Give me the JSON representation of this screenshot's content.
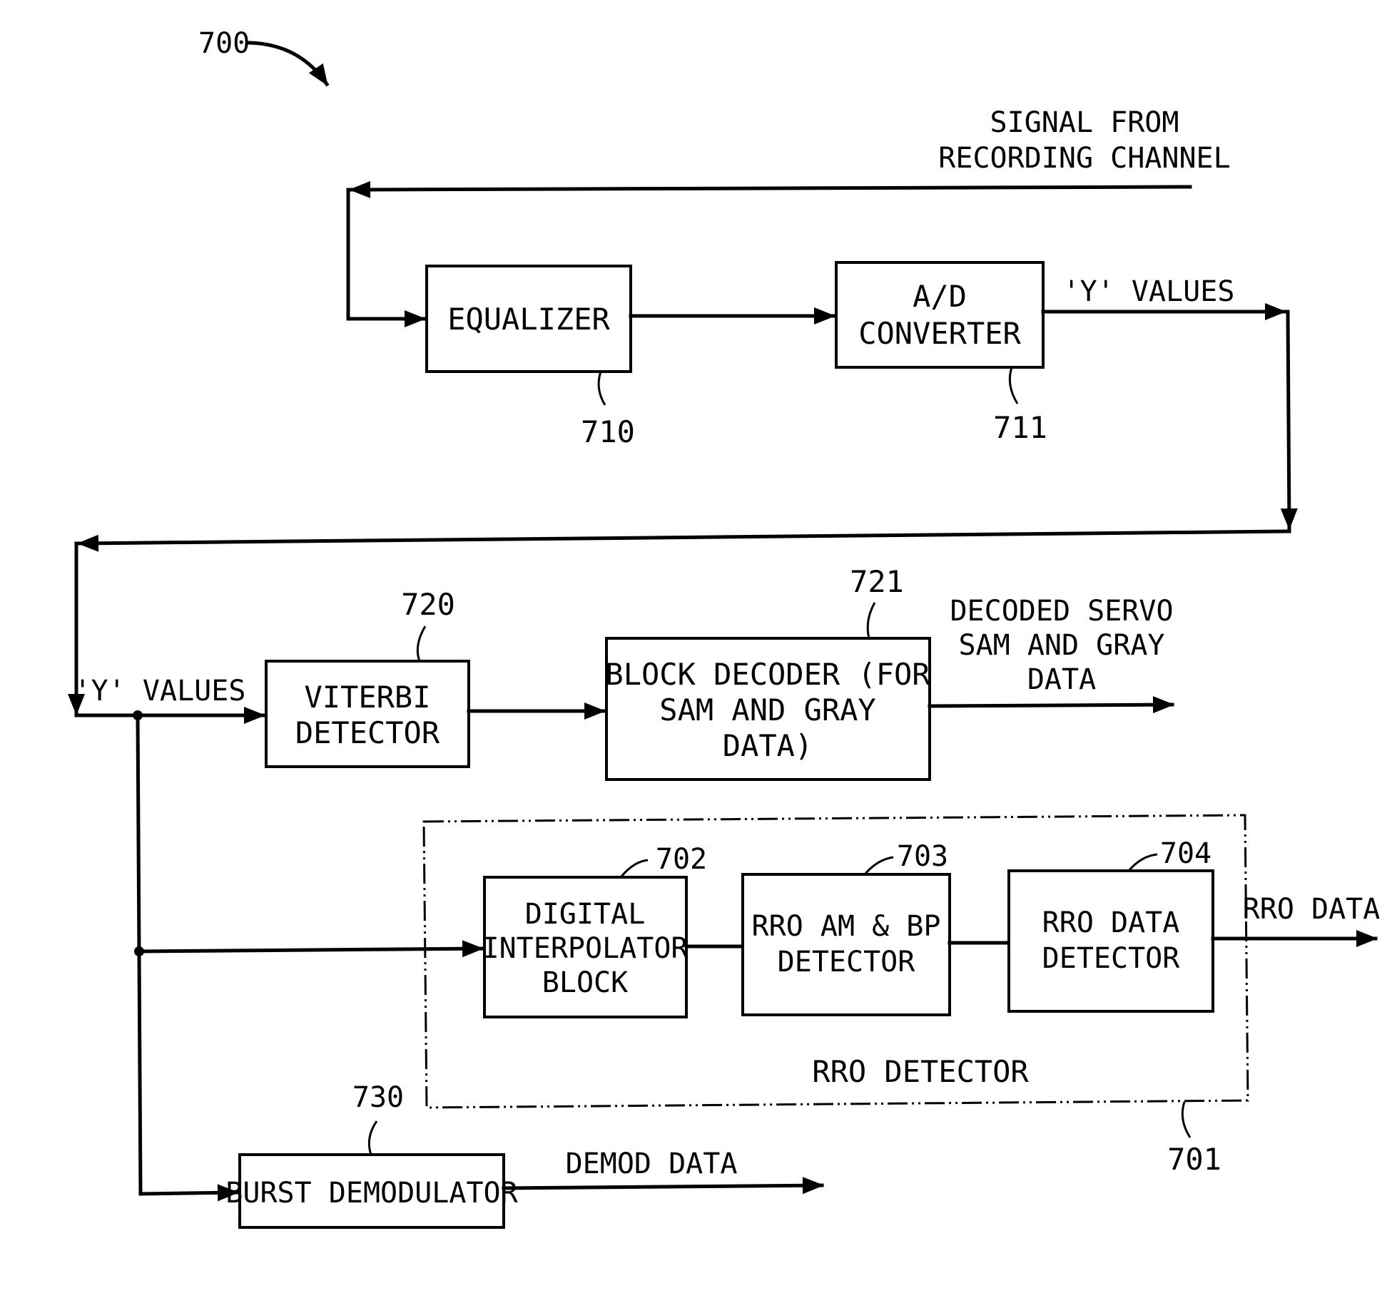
{
  "figure": {
    "ref": "700",
    "input_label": [
      "SIGNAL FROM",
      "RECORDING CHANNEL"
    ],
    "y_values_top": "'Y' VALUES",
    "y_values_left": "'Y' VALUES"
  },
  "blocks": {
    "equalizer": {
      "lines": [
        "EQUALIZER"
      ],
      "ref": "710"
    },
    "ad_converter": {
      "lines": [
        "A/D",
        "CONVERTER"
      ],
      "ref": "711"
    },
    "viterbi": {
      "lines": [
        "VITERBI",
        "DETECTOR"
      ],
      "ref": "720"
    },
    "block_decoder": {
      "lines": [
        "BLOCK DECODER (FOR",
        "SAM AND GRAY",
        "DATA)"
      ],
      "ref": "721"
    },
    "digital_interpolator": {
      "lines": [
        "DIGITAL",
        "INTERPOLATOR",
        "BLOCK"
      ],
      "ref": "702"
    },
    "rro_am_bp": {
      "lines": [
        "RRO AM & BP",
        "DETECTOR"
      ],
      "ref": "703"
    },
    "rro_data_detector": {
      "lines": [
        "RRO DATA",
        "DETECTOR"
      ],
      "ref": "704"
    },
    "burst_demodulator": {
      "lines": [
        "BURST DEMODULATOR"
      ],
      "ref": "730"
    }
  },
  "group": {
    "label": "RRO DETECTOR",
    "ref": "701"
  },
  "outputs": {
    "decoded": [
      "DECODED SERVO",
      "SAM AND GRAY",
      "DATA"
    ],
    "rro": "RRO DATA",
    "demod": "DEMOD DATA"
  }
}
